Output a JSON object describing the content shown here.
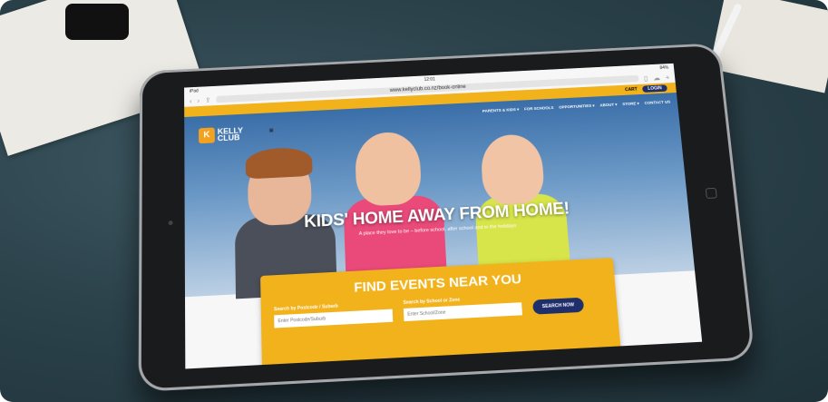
{
  "status": {
    "device": "iPad",
    "time": "12:01",
    "battery": "84%"
  },
  "browser": {
    "url": "www.kellyclub.co.nz/book-online"
  },
  "topbar": {
    "cart": "CART",
    "login": "LOGIN"
  },
  "nav": {
    "items": [
      "PARENTS & KIDS ▾",
      "FOR SCHOOLS",
      "OPPORTUNITIES ▾",
      "ABOUT ▾",
      "STORE ▾",
      "CONTACT US"
    ]
  },
  "logo": {
    "mark": "K",
    "line1": "KELLY",
    "line2": "CLUB"
  },
  "hero": {
    "headline": "KIDS' HOME AWAY FROM HOME!",
    "subline": "A place they love to be – before school, after school and in the holidays"
  },
  "finder": {
    "title": "FIND EVENTS NEAR YOU",
    "postcode_label": "Search by Postcode / Suburb",
    "postcode_placeholder": "Enter Postcode/Suburb",
    "school_label": "Search by School or Zone",
    "school_placeholder": "Enter School/Zone",
    "button": "SEARCH NOW"
  },
  "colors": {
    "brand_yellow": "#f2b21c",
    "brand_navy": "#1f2f6b"
  },
  "icons": {
    "back": "chevron-left-icon",
    "forward": "chevron-right-icon",
    "share": "share-icon",
    "bookmarks": "book-icon",
    "cloud": "cloud-icon",
    "add": "plus-icon"
  }
}
